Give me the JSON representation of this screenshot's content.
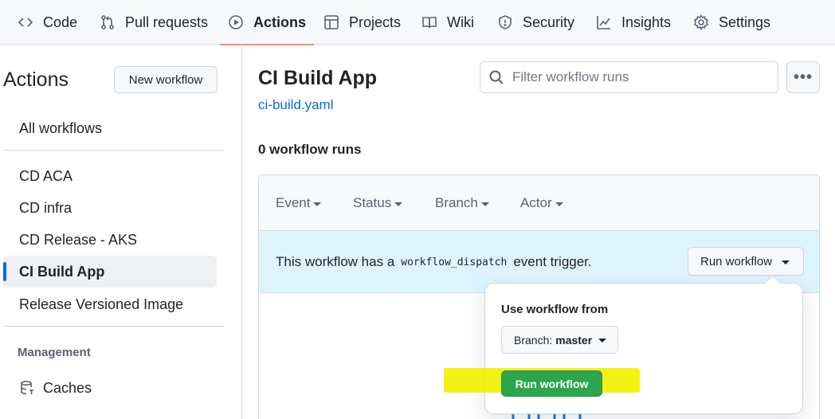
{
  "nav": {
    "tabs": [
      {
        "label": "Code",
        "icon": "code-icon"
      },
      {
        "label": "Pull requests",
        "icon": "git-pull-request-icon"
      },
      {
        "label": "Actions",
        "icon": "play-icon",
        "active": true
      },
      {
        "label": "Projects",
        "icon": "table-icon"
      },
      {
        "label": "Wiki",
        "icon": "book-icon"
      },
      {
        "label": "Security",
        "icon": "shield-icon"
      },
      {
        "label": "Insights",
        "icon": "graph-icon"
      },
      {
        "label": "Settings",
        "icon": "gear-icon"
      }
    ],
    "active_color": "#fd8c73"
  },
  "sidebar": {
    "title": "Actions",
    "new_workflow_label": "New workflow",
    "all_workflows": "All workflows",
    "workflows": [
      {
        "label": "CD ACA"
      },
      {
        "label": "CD infra"
      },
      {
        "label": "CD Release - AKS"
      },
      {
        "label": "CI Build App",
        "active": true
      },
      {
        "label": "Release Versioned Image"
      }
    ],
    "management_label": "Management",
    "caches_label": "Caches",
    "caches_icon": "database-icon"
  },
  "main": {
    "title": "CI Build App",
    "file_link": "ci-build.yaml",
    "runs_count": "0 workflow runs",
    "search_placeholder": "Filter workflow runs",
    "search_icon": "search-icon",
    "more_icon": "kebab-horizontal-icon",
    "filters": [
      "Event",
      "Status",
      "Branch",
      "Actor"
    ],
    "dispatch": {
      "prefix": "This workflow has a",
      "code": "workflow_dispatch",
      "suffix": "event trigger.",
      "button_label": "Run workflow"
    },
    "popover": {
      "label": "Use workflow from",
      "branch_prefix": "Branch:",
      "branch_value": "master",
      "run_button_label": "Run workflow"
    }
  },
  "colors": {
    "link": "#0969da",
    "run_green": "#2da44e",
    "highlight": "#f5f000",
    "dispatch_bg": "#ddf4ff"
  }
}
